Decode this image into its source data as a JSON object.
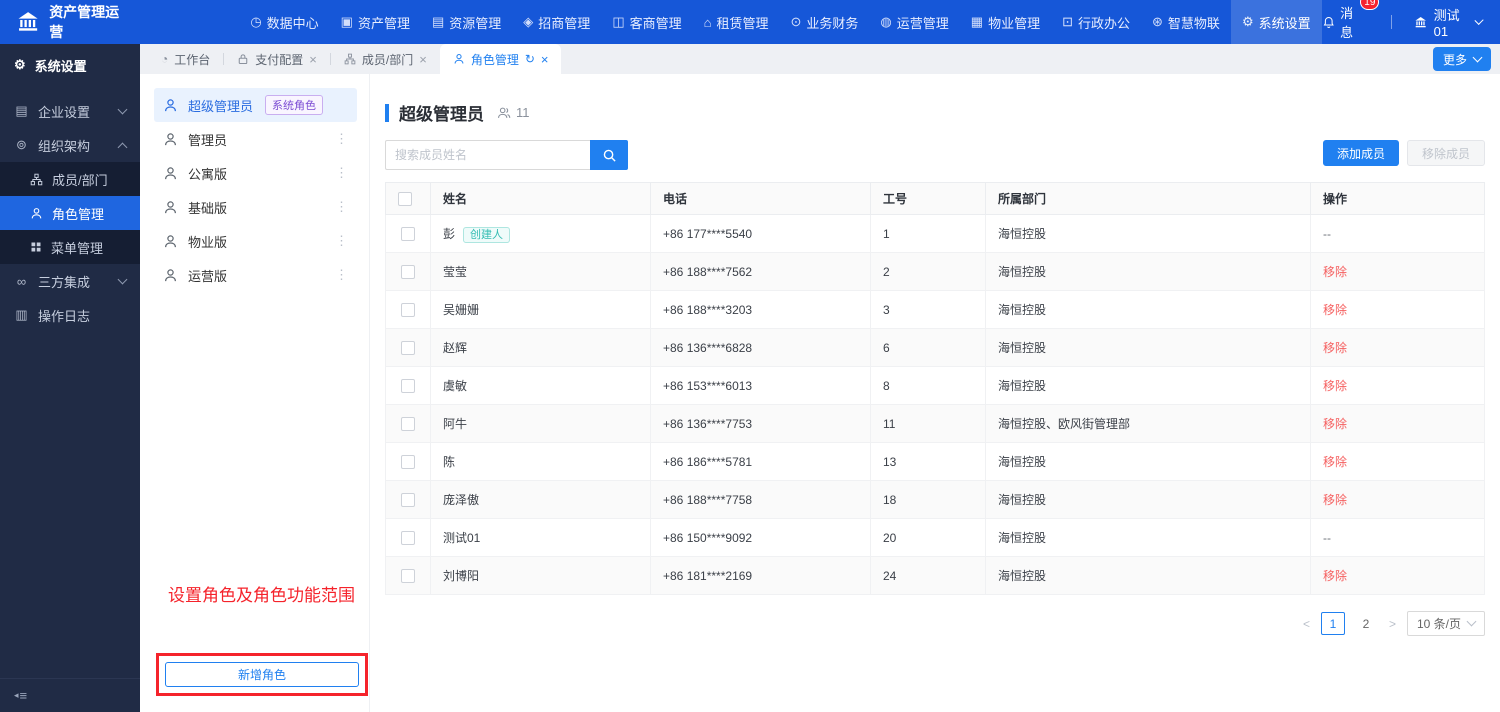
{
  "colors": {
    "navbar_blue": "#1657d8",
    "primary_blue": "#2080f0",
    "sidebar_dark": "#202b45",
    "sidebar_active_blue": "#1f66e0",
    "danger_red": "#f5232b",
    "remove_link_red": "#f56060",
    "system_role_badge_purple": "#7c4dd4",
    "creator_badge_teal": "#36bdb4"
  },
  "icons": {
    "data_center": "◷",
    "asset": "▣",
    "resource": "▤",
    "invest": "◈",
    "merchant": "◫",
    "lease": "⌂",
    "finance": "⊙",
    "operation": "◍",
    "property": "▦",
    "office": "⊡",
    "iot": "⊛",
    "gear": "⚙",
    "company": "▤",
    "org_group": "⊚",
    "integration": "∞",
    "log": "▥",
    "workbench": "◔",
    "dots": "⋮",
    "refresh": "↻",
    "close": "×",
    "fold": "≡",
    "fold_arrow": "◂"
  },
  "navbar": {
    "logo_text": "资产管理运营",
    "items": [
      {
        "label": "数据中心"
      },
      {
        "label": "资产管理"
      },
      {
        "label": "资源管理"
      },
      {
        "label": "招商管理"
      },
      {
        "label": "客商管理"
      },
      {
        "label": "租赁管理"
      },
      {
        "label": "业务财务"
      },
      {
        "label": "运营管理"
      },
      {
        "label": "物业管理"
      },
      {
        "label": "行政办公"
      },
      {
        "label": "智慧物联"
      },
      {
        "label": "系统设置",
        "active": true
      }
    ],
    "message_label": "消息",
    "message_count": "19",
    "user_label": "测试01"
  },
  "sidebar": {
    "title": "系统设置",
    "items": [
      {
        "label": "企业设置"
      },
      {
        "label": "组织架构"
      },
      {
        "label": "成员/部门"
      },
      {
        "label": "角色管理",
        "active": true
      },
      {
        "label": "菜单管理"
      },
      {
        "label": "三方集成"
      },
      {
        "label": "操作日志"
      }
    ]
  },
  "tabs": {
    "items": [
      {
        "label": "工作台"
      },
      {
        "label": "支付配置"
      },
      {
        "label": "成员/部门"
      },
      {
        "label": "角色管理",
        "active": true
      }
    ],
    "more_label": "更多"
  },
  "roles": {
    "items": [
      {
        "label": "超级管理员",
        "badge": "系统角色",
        "active": true
      },
      {
        "label": "管理员"
      },
      {
        "label": "公寓版"
      },
      {
        "label": "基础版"
      },
      {
        "label": "物业版"
      },
      {
        "label": "运营版"
      }
    ],
    "add_button_label": "新增角色"
  },
  "annotation": {
    "text": "设置角色及角色功能范围"
  },
  "main": {
    "title": "超级管理员",
    "member_count": "11",
    "search_placeholder": "搜索成员姓名",
    "add_member_label": "添加成员",
    "remove_member_label": "移除成员"
  },
  "table": {
    "headers": [
      "姓名",
      "电话",
      "工号",
      "所属部门",
      "操作"
    ],
    "rows": [
      {
        "name": "彭",
        "badge": "创建人",
        "phone": "+86 177****5540",
        "emp_id": "1",
        "dept": "海恒控股",
        "op": "--"
      },
      {
        "name": "莹莹",
        "phone": "+86 188****7562",
        "emp_id": "2",
        "dept": "海恒控股",
        "op": "移除"
      },
      {
        "name": "吴姗姗",
        "phone": "+86 188****3203",
        "emp_id": "3",
        "dept": "海恒控股",
        "op": "移除"
      },
      {
        "name": "赵辉",
        "phone": "+86 136****6828",
        "emp_id": "6",
        "dept": "海恒控股",
        "op": "移除"
      },
      {
        "name": "虞敏",
        "phone": "+86 153****6013",
        "emp_id": "8",
        "dept": "海恒控股",
        "op": "移除"
      },
      {
        "name": "阿牛",
        "phone": "+86 136****7753",
        "emp_id": "11",
        "dept": "海恒控股、欧风街管理部",
        "op": "移除"
      },
      {
        "name": "陈",
        "phone": "+86 186****5781",
        "emp_id": "13",
        "dept": "海恒控股",
        "op": "移除"
      },
      {
        "name": "庞泽傲",
        "phone": "+86 188****7758",
        "emp_id": "18",
        "dept": "海恒控股",
        "op": "移除"
      },
      {
        "name": "测试01",
        "phone": "+86 150****9092",
        "emp_id": "20",
        "dept": "海恒控股",
        "op": "--"
      },
      {
        "name": "刘博阳",
        "phone": "+86 181****2169",
        "emp_id": "24",
        "dept": "海恒控股",
        "op": "移除"
      }
    ]
  },
  "pagination": {
    "prev": "<",
    "pages": [
      "1",
      "2"
    ],
    "active_page": "1",
    "next": ">",
    "page_size": "10 条/页"
  }
}
